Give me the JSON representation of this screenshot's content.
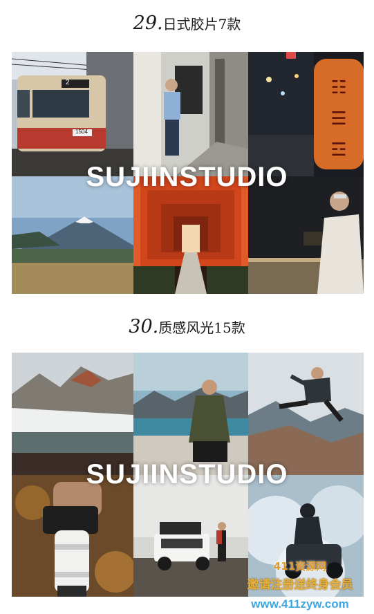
{
  "section1": {
    "number": "29.",
    "title": "日式胶片7款"
  },
  "section2": {
    "number": "30.",
    "title": "质感风光15款"
  },
  "watermark": "SUJIINSTUDIO",
  "train_sign": "2",
  "train_plate": "1504",
  "site_badge": {
    "name": "411资源网",
    "slogan": "邀请注册送终身会员",
    "url": "www.411zyw.com"
  },
  "colors": {
    "badge_name": "#e09a2a",
    "badge_slogan": "#e6b23c",
    "badge_url": "#3ea7e0",
    "torii": "#d2461c"
  }
}
